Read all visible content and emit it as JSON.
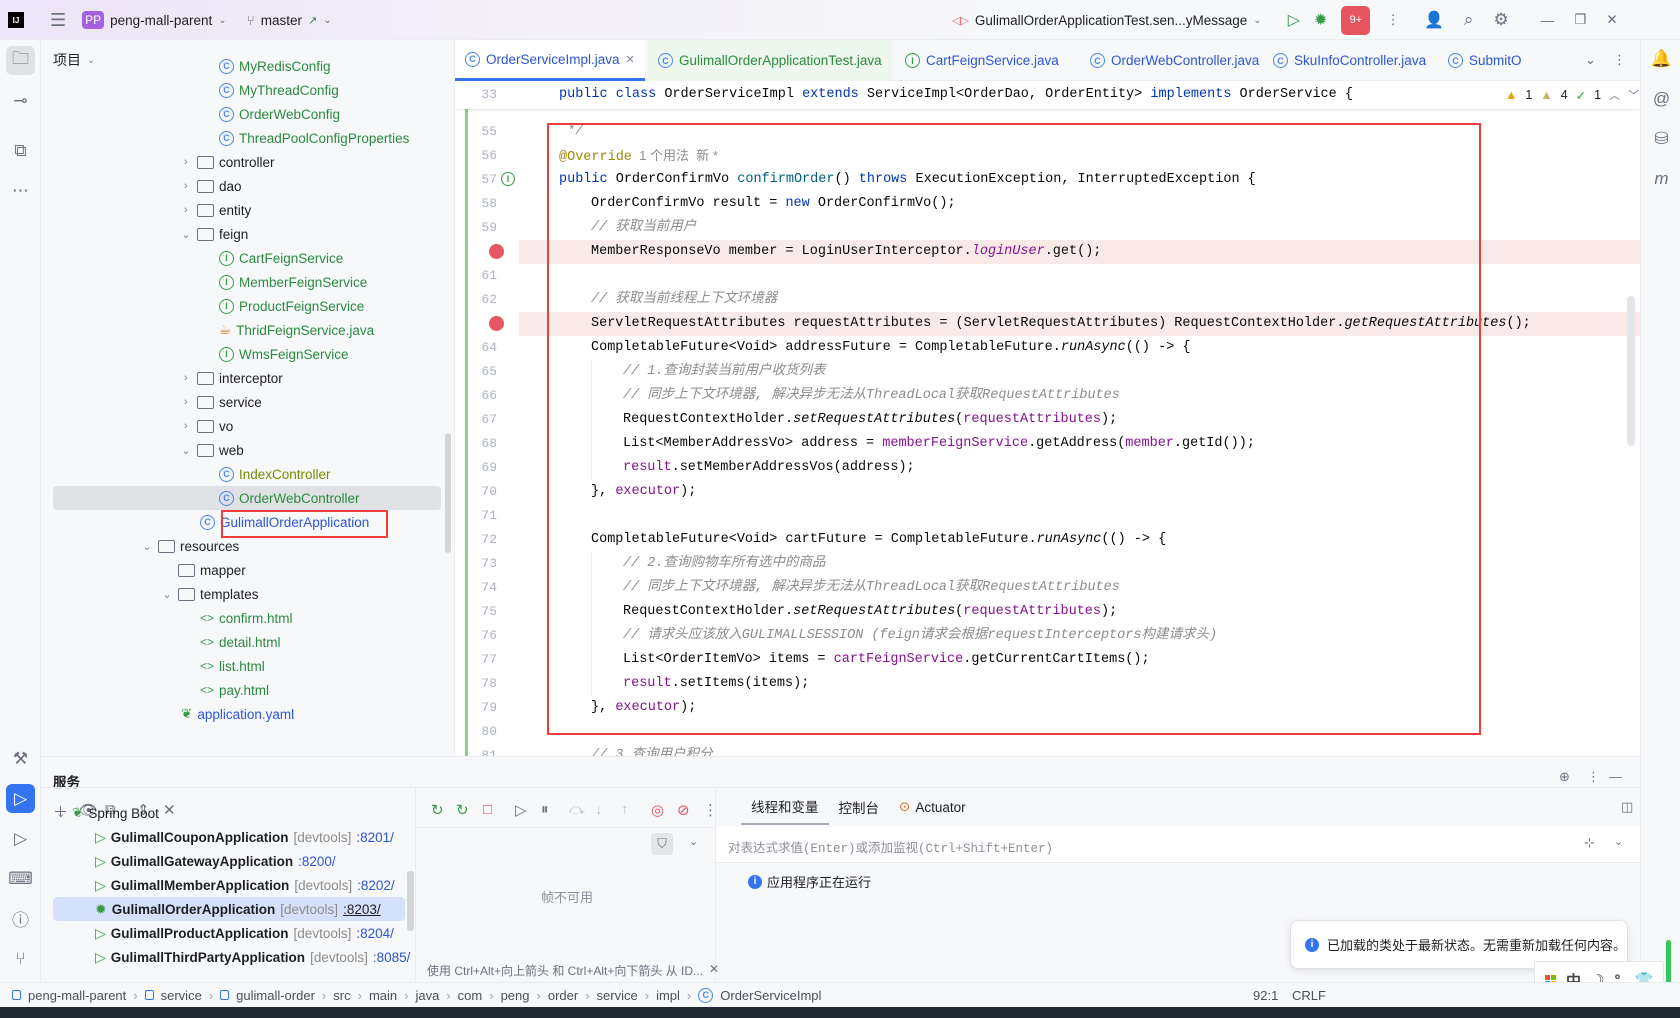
{
  "titlebar": {
    "project_badge": "PP",
    "project_name": "peng-mall-parent",
    "branch": "master",
    "run_config": "GulimallOrderApplicationTest.sen...yMessage",
    "badge_count": "9+"
  },
  "project_panel": {
    "title": "项目",
    "items": [
      {
        "label": "MyRedisConfig",
        "type": "class",
        "level": 4,
        "color": "green"
      },
      {
        "label": "MyThreadConfig",
        "type": "class",
        "level": 4,
        "color": "green"
      },
      {
        "label": "OrderWebConfig",
        "type": "class",
        "level": 4,
        "color": "green"
      },
      {
        "label": "ThreadPoolConfigProperties",
        "type": "class",
        "level": 4,
        "color": "green"
      },
      {
        "label": "controller",
        "type": "package",
        "level": 3,
        "expanded": false
      },
      {
        "label": "dao",
        "type": "package",
        "level": 3,
        "expanded": false
      },
      {
        "label": "entity",
        "type": "package",
        "level": 3,
        "expanded": false
      },
      {
        "label": "feign",
        "type": "package",
        "level": 3,
        "expanded": true
      },
      {
        "label": "CartFeignService",
        "type": "interface",
        "level": 4,
        "color": "green"
      },
      {
        "label": "MemberFeignService",
        "type": "interface",
        "level": 4,
        "color": "green"
      },
      {
        "label": "ProductFeignService",
        "type": "interface",
        "level": 4,
        "color": "green"
      },
      {
        "label": "ThridFeignService.java",
        "type": "java",
        "level": 4,
        "color": "green"
      },
      {
        "label": "WmsFeignService",
        "type": "interface",
        "level": 4,
        "color": "green"
      },
      {
        "label": "interceptor",
        "type": "package",
        "level": 3,
        "expanded": false
      },
      {
        "label": "service",
        "type": "package",
        "level": 3,
        "expanded": false
      },
      {
        "label": "vo",
        "type": "package",
        "level": 3,
        "expanded": false
      },
      {
        "label": "web",
        "type": "package",
        "level": 3,
        "expanded": true
      },
      {
        "label": "IndexController",
        "type": "class",
        "level": 4,
        "color": "olive"
      },
      {
        "label": "OrderWebController",
        "type": "class",
        "level": 4,
        "color": "green",
        "selected": true
      },
      {
        "label": "GulimallOrderApplication",
        "type": "app",
        "level": 3,
        "color": "blue"
      },
      {
        "label": "resources",
        "type": "resources",
        "level": 1,
        "expanded": true
      },
      {
        "label": "mapper",
        "type": "folder",
        "level": 2
      },
      {
        "label": "templates",
        "type": "folder",
        "level": 2,
        "expanded": true
      },
      {
        "label": "confirm.html",
        "type": "html",
        "level": 3,
        "color": "green"
      },
      {
        "label": "detail.html",
        "type": "html",
        "level": 3,
        "color": "green"
      },
      {
        "label": "list.html",
        "type": "html",
        "level": 3,
        "color": "green"
      },
      {
        "label": "pay.html",
        "type": "html",
        "level": 3,
        "color": "green"
      },
      {
        "label": "application.yaml",
        "type": "yaml",
        "level": 2,
        "color": "blue"
      }
    ]
  },
  "tabs": [
    {
      "label": "OrderServiceImpl.java",
      "icon": "class",
      "active": true
    },
    {
      "label": "GulimallOrderApplicationTest.java",
      "icon": "test-class"
    },
    {
      "label": "CartFeignService.java",
      "icon": "interface"
    },
    {
      "label": "OrderWebController.java",
      "icon": "class"
    },
    {
      "label": "SkuInfoController.java",
      "icon": "class"
    },
    {
      "label": "SubmitO",
      "icon": "class"
    }
  ],
  "inspections": {
    "warnings": "1",
    "weak_warnings": "4",
    "ok": "1"
  },
  "editor": {
    "sticky": {
      "num": "33",
      "tokens": [
        [
          "public class ",
          "kw"
        ],
        [
          "OrderServiceImpl ",
          ""
        ],
        [
          "extends ",
          "kw"
        ],
        [
          "ServiceImpl<OrderDao, OrderEntity> ",
          ""
        ],
        [
          "implements ",
          "kw"
        ],
        [
          "OrderService {",
          ""
        ]
      ]
    },
    "lines": [
      {
        "num": "55",
        "indent": 1,
        "tokens": [
          [
            " */",
            "cm"
          ]
        ]
      },
      {
        "num": "56",
        "indent": 1,
        "tokens": [
          [
            "@Override",
            "an"
          ],
          [
            "  1 个用法  新 *",
            "hint"
          ]
        ]
      },
      {
        "num": "57",
        "indent": 1,
        "gutter": "implements",
        "tokens": [
          [
            "public ",
            "kw"
          ],
          [
            "OrderConfirmVo ",
            ""
          ],
          [
            "confirmOrder",
            "md"
          ],
          [
            "() ",
            ""
          ],
          [
            "throws ",
            "kw"
          ],
          [
            "ExecutionException, InterruptedException {",
            ""
          ]
        ]
      },
      {
        "num": "58",
        "indent": 2,
        "tokens": [
          [
            "OrderConfirmVo result = ",
            ""
          ],
          [
            "new ",
            "kw"
          ],
          [
            "OrderConfirmVo();",
            ""
          ]
        ]
      },
      {
        "num": "59",
        "indent": 2,
        "tokens": [
          [
            "// 获取当前用户",
            "cm"
          ]
        ]
      },
      {
        "num": "60",
        "indent": 2,
        "breakpoint": true,
        "tokens": [
          [
            "MemberResponseVo member = LoginUserInterceptor.",
            ""
          ],
          [
            "loginUser",
            "stf"
          ],
          [
            ".get();",
            ""
          ]
        ]
      },
      {
        "num": "61",
        "indent": 2,
        "tokens": []
      },
      {
        "num": "62",
        "indent": 2,
        "tokens": [
          [
            "// 获取当前线程上下文环境器",
            "cm"
          ]
        ]
      },
      {
        "num": "63",
        "indent": 2,
        "breakpoint": true,
        "tokens": [
          [
            "ServletRequestAttributes requestAttributes = (ServletRequestAttributes) RequestContextHolder.",
            ""
          ],
          [
            "getRequestAttributes",
            "st"
          ],
          [
            "();",
            ""
          ]
        ]
      },
      {
        "num": "64",
        "indent": 2,
        "tokens": [
          [
            "CompletableFuture<Void> addressFuture = CompletableFuture.",
            ""
          ],
          [
            "runAsync",
            "st"
          ],
          [
            "(() -> {",
            ""
          ]
        ]
      },
      {
        "num": "65",
        "indent": 3,
        "tokens": [
          [
            "// 1.查询封装当前用户收货列表",
            "cm"
          ]
        ]
      },
      {
        "num": "66",
        "indent": 3,
        "tokens": [
          [
            "// 同步上下文环境器, 解决异步无法从ThreadLocal获取RequestAttributes",
            "cm"
          ]
        ]
      },
      {
        "num": "67",
        "indent": 3,
        "tokens": [
          [
            "RequestContextHolder.",
            ""
          ],
          [
            "setRequestAttributes",
            "st"
          ],
          [
            "(",
            ""
          ],
          [
            "requestAttributes",
            "fld"
          ],
          [
            ");",
            ""
          ]
        ]
      },
      {
        "num": "68",
        "indent": 3,
        "tokens": [
          [
            "List<MemberAddressVo> address = ",
            ""
          ],
          [
            "memberFeignService",
            "fld"
          ],
          [
            ".getAddress(",
            ""
          ],
          [
            "member",
            "fld"
          ],
          [
            ".getId());",
            ""
          ]
        ]
      },
      {
        "num": "69",
        "indent": 3,
        "tokens": [
          [
            "result",
            "fld"
          ],
          [
            ".setMemberAddressVos(address);",
            ""
          ]
        ]
      },
      {
        "num": "70",
        "indent": 2,
        "tokens": [
          [
            "}, ",
            ""
          ],
          [
            "executor",
            "fld"
          ],
          [
            ");",
            ""
          ]
        ]
      },
      {
        "num": "71",
        "indent": 2,
        "tokens": []
      },
      {
        "num": "72",
        "indent": 2,
        "tokens": [
          [
            "CompletableFuture<Void> cartFuture = CompletableFuture.",
            ""
          ],
          [
            "runAsync",
            "st"
          ],
          [
            "(() -> {",
            ""
          ]
        ]
      },
      {
        "num": "73",
        "indent": 3,
        "tokens": [
          [
            "// 2.查询购物车所有选中的商品",
            "cm"
          ]
        ]
      },
      {
        "num": "74",
        "indent": 3,
        "tokens": [
          [
            "// 同步上下文环境器, 解决异步无法从ThreadLocal获取RequestAttributes",
            "cm"
          ]
        ]
      },
      {
        "num": "75",
        "indent": 3,
        "tokens": [
          [
            "RequestContextHolder.",
            ""
          ],
          [
            "setRequestAttributes",
            "st"
          ],
          [
            "(",
            ""
          ],
          [
            "requestAttributes",
            "fld"
          ],
          [
            ");",
            ""
          ]
        ]
      },
      {
        "num": "76",
        "indent": 3,
        "tokens": [
          [
            "// 请求头应该放入GULIMALLSESSION (feign请求会根据requestInterceptors构建请求头)",
            "cm"
          ]
        ]
      },
      {
        "num": "77",
        "indent": 3,
        "tokens": [
          [
            "List<OrderItemVo> items = ",
            ""
          ],
          [
            "cartFeignService",
            "fld"
          ],
          [
            ".getCurrentCartItems();",
            ""
          ]
        ]
      },
      {
        "num": "78",
        "indent": 3,
        "tokens": [
          [
            "result",
            "fld"
          ],
          [
            ".setItems(items);",
            ""
          ]
        ]
      },
      {
        "num": "79",
        "indent": 2,
        "tokens": [
          [
            "}, ",
            ""
          ],
          [
            "executor",
            "fld"
          ],
          [
            ");",
            ""
          ]
        ]
      },
      {
        "num": "80",
        "indent": 2,
        "tokens": []
      },
      {
        "num": "81",
        "indent": 2,
        "tokens": [
          [
            "// 3.查询用户积分",
            "cm"
          ]
        ]
      }
    ]
  },
  "services": {
    "title": "服务",
    "group": "Spring Boot",
    "apps": [
      {
        "name": "GulimallCouponApplication",
        "tag": "[devtools]",
        "port": ":8201/",
        "state": "run"
      },
      {
        "name": "GulimallGatewayApplication",
        "tag": "",
        "port": ":8200/",
        "state": "run"
      },
      {
        "name": "GulimallMemberApplication",
        "tag": "[devtools]",
        "port": ":8202/",
        "state": "run"
      },
      {
        "name": "GulimallOrderApplication",
        "tag": "[devtools]",
        "port": ":8203/",
        "state": "debug",
        "selected": true
      },
      {
        "name": "GulimallProductApplication",
        "tag": "[devtools]",
        "port": ":8204/",
        "state": "run"
      },
      {
        "name": "GulimallThirdPartyApplication",
        "tag": "[devtools]",
        "port": ":8085/",
        "state": "run"
      }
    ]
  },
  "debugger": {
    "tabs": [
      "线程和变量",
      "控制台",
      "Actuator"
    ],
    "frames_empty": "帧不可用",
    "frames_hint": "使用 Ctrl+Alt+向上箭头 和 Ctrl+Alt+向下箭头 从 ID...",
    "eval_placeholder": "对表达式求值(Enter)或添加监视(Ctrl+Shift+Enter)",
    "status": "应用程序正在运行"
  },
  "notification": "已加载的类处于最新状态。无需重新加载任何内容。",
  "ime": {
    "mode": "中",
    "punct": "°,"
  },
  "statusbar": {
    "breadcrumb": [
      "peng-mall-parent",
      "service",
      "gulimall-order",
      "src",
      "main",
      "java",
      "com",
      "peng",
      "order",
      "service",
      "impl",
      "OrderServiceImpl"
    ],
    "position": "92:1",
    "line_ending": "CRLF"
  }
}
